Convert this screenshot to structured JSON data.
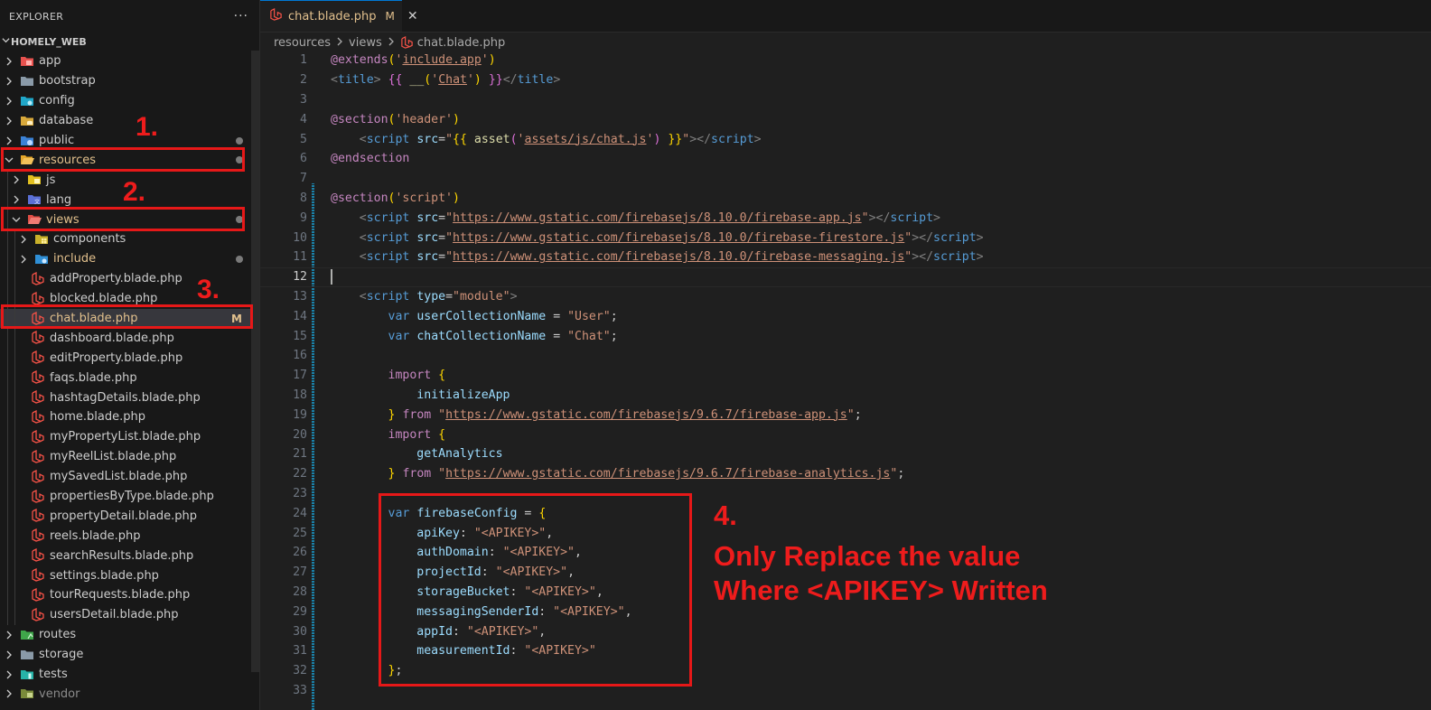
{
  "explorer": {
    "title": "EXPLORER",
    "more": "···",
    "root": "HOMELY_WEB",
    "items": [
      {
        "label": "app",
        "type": "folder",
        "icon": "folder-app-icon",
        "depth": 0,
        "expanded": false
      },
      {
        "label": "bootstrap",
        "type": "folder",
        "icon": "folder-icon",
        "depth": 0,
        "expanded": false
      },
      {
        "label": "config",
        "type": "folder",
        "icon": "folder-config-icon",
        "depth": 0,
        "expanded": false
      },
      {
        "label": "database",
        "type": "folder",
        "icon": "folder-database-icon",
        "depth": 0,
        "expanded": false
      },
      {
        "label": "public",
        "type": "folder",
        "icon": "folder-public-icon",
        "depth": 0,
        "expanded": false,
        "dot": true
      },
      {
        "label": "resources",
        "type": "folder",
        "icon": "folder-resources-open-icon",
        "depth": 0,
        "expanded": true,
        "modified": true,
        "dot": true
      },
      {
        "label": "js",
        "type": "folder",
        "icon": "folder-js-icon",
        "depth": 1,
        "expanded": false
      },
      {
        "label": "lang",
        "type": "folder",
        "icon": "folder-lang-icon",
        "depth": 1,
        "expanded": false
      },
      {
        "label": "views",
        "type": "folder",
        "icon": "folder-views-open-icon",
        "depth": 1,
        "expanded": true,
        "modified": true,
        "dot": true
      },
      {
        "label": "components",
        "type": "folder",
        "icon": "folder-components-icon",
        "depth": 2,
        "expanded": false
      },
      {
        "label": "include",
        "type": "folder",
        "icon": "folder-include-icon",
        "depth": 2,
        "expanded": false,
        "modified": true,
        "dot": true
      },
      {
        "label": "addProperty.blade.php",
        "type": "file",
        "depth": 2
      },
      {
        "label": "blocked.blade.php",
        "type": "file",
        "depth": 2
      },
      {
        "label": "chat.blade.php",
        "type": "file",
        "depth": 2,
        "modified": true,
        "selected": true,
        "badge": "M"
      },
      {
        "label": "dashboard.blade.php",
        "type": "file",
        "depth": 2
      },
      {
        "label": "editProperty.blade.php",
        "type": "file",
        "depth": 2
      },
      {
        "label": "faqs.blade.php",
        "type": "file",
        "depth": 2
      },
      {
        "label": "hashtagDetails.blade.php",
        "type": "file",
        "depth": 2
      },
      {
        "label": "home.blade.php",
        "type": "file",
        "depth": 2
      },
      {
        "label": "myPropertyList.blade.php",
        "type": "file",
        "depth": 2
      },
      {
        "label": "myReelList.blade.php",
        "type": "file",
        "depth": 2
      },
      {
        "label": "mySavedList.blade.php",
        "type": "file",
        "depth": 2
      },
      {
        "label": "propertiesByType.blade.php",
        "type": "file",
        "depth": 2
      },
      {
        "label": "propertyDetail.blade.php",
        "type": "file",
        "depth": 2
      },
      {
        "label": "reels.blade.php",
        "type": "file",
        "depth": 2
      },
      {
        "label": "searchResults.blade.php",
        "type": "file",
        "depth": 2
      },
      {
        "label": "settings.blade.php",
        "type": "file",
        "depth": 2
      },
      {
        "label": "tourRequests.blade.php",
        "type": "file",
        "depth": 2
      },
      {
        "label": "usersDetail.blade.php",
        "type": "file",
        "depth": 2
      },
      {
        "label": "routes",
        "type": "folder",
        "icon": "folder-routes-icon",
        "depth": 0,
        "expanded": false
      },
      {
        "label": "storage",
        "type": "folder",
        "icon": "folder-icon",
        "depth": 0,
        "expanded": false
      },
      {
        "label": "tests",
        "type": "folder",
        "icon": "folder-tests-icon",
        "depth": 0,
        "expanded": false
      },
      {
        "label": "vendor",
        "type": "folder",
        "icon": "folder-vendor-icon",
        "depth": 0,
        "expanded": false,
        "dim": true
      }
    ]
  },
  "tab": {
    "label": "chat.blade.php",
    "status": "M",
    "close": "✕"
  },
  "breadcrumb": [
    "resources",
    "views",
    "chat.blade.php"
  ],
  "code_lines": [
    {
      "n": "1",
      "html": "<span class='blade'>@extends</span><span class='br1'>(</span><span class='str'>'<u>include.app</u>'</span><span class='br1'>)</span>"
    },
    {
      "n": "2",
      "html": "<span class='tag'>&lt;</span><span class='tagn'>title</span><span class='tag'>&gt;</span> <span class='br2'>{{</span> <span class='fn'>__</span><span class='br1'>(</span><span class='str'>'<u>Chat</u>'</span><span class='br1'>)</span> <span class='br2'>}}</span><span class='tag'>&lt;/</span><span class='tagn'>title</span><span class='tag'>&gt;</span>"
    },
    {
      "n": "3",
      "html": ""
    },
    {
      "n": "4",
      "html": "<span class='blade'>@section</span><span class='br1'>(</span><span class='str'>'header'</span><span class='br1'>)</span>"
    },
    {
      "n": "5",
      "html": "    <span class='tag'>&lt;</span><span class='tagn'>script</span> <span class='attr'>src</span><span class='plain'>=</span><span class='str'>\"</span><span class='br1'>{{</span> <span class='fn'>asset</span><span class='br2'>(</span><span class='str'>'<u>assets/js/chat.js</u>'</span><span class='br2'>)</span> <span class='br1'>}}</span><span class='str'>\"</span><span class='tag'>&gt;&lt;/</span><span class='tagn'>script</span><span class='tag'>&gt;</span>"
    },
    {
      "n": "6",
      "html": "<span class='blade'>@endsection</span>"
    },
    {
      "n": "7",
      "html": ""
    },
    {
      "n": "8",
      "html": "<span class='blade'>@section</span><span class='br1'>(</span><span class='str'>'script'</span><span class='br1'>)</span>"
    },
    {
      "n": "9",
      "html": "    <span class='tag'>&lt;</span><span class='tagn'>script</span> <span class='attr'>src</span><span class='plain'>=</span><span class='str'>\"</span><span class='url'>https://www.gstatic.com/firebasejs/8.10.0/firebase-app.js</span><span class='str'>\"</span><span class='tag'>&gt;&lt;/</span><span class='tagn'>script</span><span class='tag'>&gt;</span>"
    },
    {
      "n": "10",
      "html": "    <span class='tag'>&lt;</span><span class='tagn'>script</span> <span class='attr'>src</span><span class='plain'>=</span><span class='str'>\"</span><span class='url'>https://www.gstatic.com/firebasejs/8.10.0/firebase-firestore.js</span><span class='str'>\"</span><span class='tag'>&gt;&lt;/</span><span class='tagn'>script</span><span class='tag'>&gt;</span>"
    },
    {
      "n": "11",
      "html": "    <span class='tag'>&lt;</span><span class='tagn'>script</span> <span class='attr'>src</span><span class='plain'>=</span><span class='str'>\"</span><span class='url'>https://www.gstatic.com/firebasejs/8.10.0/firebase-messaging.js</span><span class='str'>\"</span><span class='tag'>&gt;&lt;/</span><span class='tagn'>script</span><span class='tag'>&gt;</span>"
    },
    {
      "n": "12",
      "html": "CURSOR",
      "current": true
    },
    {
      "n": "13",
      "html": "    <span class='tag'>&lt;</span><span class='tagn'>script</span> <span class='attr'>type</span><span class='plain'>=</span><span class='str'>\"module\"</span><span class='tag'>&gt;</span>"
    },
    {
      "n": "14",
      "html": "        <span class='kw'>var</span> <span class='var'>userCollectionName</span> <span class='plain'>=</span> <span class='str'>\"User\"</span><span class='plain'>;</span>"
    },
    {
      "n": "15",
      "html": "        <span class='kw'>var</span> <span class='var'>chatCollectionName</span> <span class='plain'>=</span> <span class='str'>\"Chat\"</span><span class='plain'>;</span>"
    },
    {
      "n": "16",
      "html": ""
    },
    {
      "n": "17",
      "html": "        <span class='pink'>import</span> <span class='br1'>{</span>"
    },
    {
      "n": "18",
      "html": "            <span class='var'>initializeApp</span>"
    },
    {
      "n": "19",
      "html": "        <span class='br1'>}</span> <span class='pink'>from</span> <span class='str'>\"</span><span class='url'>https://www.gstatic.com/firebasejs/9.6.7/firebase-app.js</span><span class='str'>\"</span><span class='plain'>;</span>"
    },
    {
      "n": "20",
      "html": "        <span class='pink'>import</span> <span class='br1'>{</span>"
    },
    {
      "n": "21",
      "html": "            <span class='var'>getAnalytics</span>"
    },
    {
      "n": "22",
      "html": "        <span class='br1'>}</span> <span class='pink'>from</span> <span class='str'>\"</span><span class='url'>https://www.gstatic.com/firebasejs/9.6.7/firebase-analytics.js</span><span class='str'>\"</span><span class='plain'>;</span>"
    },
    {
      "n": "23",
      "html": ""
    },
    {
      "n": "24",
      "html": "        <span class='kw'>var</span> <span class='var'>firebaseConfig</span> <span class='plain'>=</span> <span class='br1'>{</span>"
    },
    {
      "n": "25",
      "html": "            <span class='prop'>apiKey</span><span class='plain'>:</span> <span class='str'>\"&lt;APIKEY&gt;\"</span><span class='plain'>,</span>"
    },
    {
      "n": "26",
      "html": "            <span class='prop'>authDomain</span><span class='plain'>:</span> <span class='str'>\"&lt;APIKEY&gt;\"</span><span class='plain'>,</span>"
    },
    {
      "n": "27",
      "html": "            <span class='prop'>projectId</span><span class='plain'>:</span> <span class='str'>\"&lt;APIKEY&gt;\"</span><span class='plain'>,</span>"
    },
    {
      "n": "28",
      "html": "            <span class='prop'>storageBucket</span><span class='plain'>:</span> <span class='str'>\"&lt;APIKEY&gt;\"</span><span class='plain'>,</span>"
    },
    {
      "n": "29",
      "html": "            <span class='prop'>messagingSenderId</span><span class='plain'>:</span> <span class='str'>\"&lt;APIKEY&gt;\"</span><span class='plain'>,</span>"
    },
    {
      "n": "30",
      "html": "            <span class='prop'>appId</span><span class='plain'>:</span> <span class='str'>\"&lt;APIKEY&gt;\"</span><span class='plain'>,</span>"
    },
    {
      "n": "31",
      "html": "            <span class='prop'>measurementId</span><span class='plain'>:</span> <span class='str'>\"&lt;APIKEY&gt;\"</span>"
    },
    {
      "n": "32",
      "html": "        <span class='br1'>}</span><span class='plain'>;</span>"
    },
    {
      "n": "33",
      "html": ""
    }
  ],
  "annotations": {
    "step1": "1.",
    "step2": "2.",
    "step3": "3.",
    "step4": "4.",
    "note_line1": "Only Replace the value",
    "note_line2": "Where <APIKEY> Written",
    "color": "#e61818"
  },
  "colors": {
    "modified": "#e2c08d",
    "selection": "#37373d",
    "accent": "#0078d4"
  }
}
